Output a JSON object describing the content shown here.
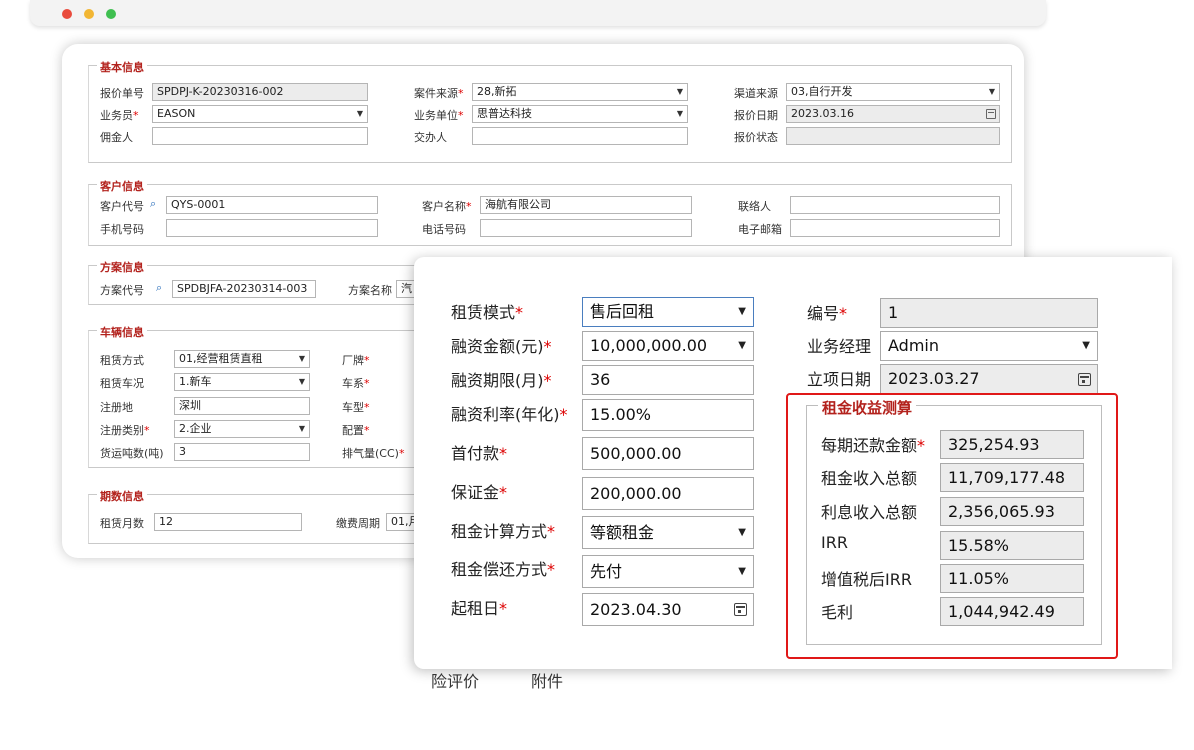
{
  "back": {
    "basic": {
      "title": "基本信息",
      "quote_no_label": "报价单号",
      "quote_no": "SPDPJ-K-20230316-002",
      "case_source_label": "案件来源",
      "case_source": "28,新拓",
      "channel_label": "渠道来源",
      "channel": "03,自行开发",
      "salesman_label": "业务员",
      "salesman": "EASON",
      "biz_unit_label": "业务单位",
      "biz_unit": "思普达科技",
      "quote_date_label": "报价日期",
      "quote_date": "2023.03.16",
      "broker_label": "佣金人",
      "handler_label": "交办人",
      "quote_status_label": "报价状态"
    },
    "customer": {
      "title": "客户信息",
      "code_label": "客户代号",
      "code": "QYS-0001",
      "name_label": "客户名称",
      "name": "海航有限公司",
      "contact_label": "联络人",
      "mobile_label": "手机号码",
      "phone_label": "电话号码",
      "email_label": "电子邮箱"
    },
    "plan": {
      "title": "方案信息",
      "code_label": "方案代号",
      "code": "SPDBJFA-20230314-003",
      "name_label": "方案名称",
      "name_partial": "汽"
    },
    "vehicle": {
      "title": "车辆信息",
      "lease_type_label": "租赁方式",
      "lease_type": "01,经营租赁直租",
      "brand_label": "厂牌",
      "condition_label": "租赁车况",
      "condition": "1.新车",
      "series_label": "车系",
      "reg_place_label": "注册地",
      "reg_place": "深圳",
      "model_label": "车型",
      "reg_type_label": "注册类别",
      "reg_type": "2.企业",
      "config_label": "配置",
      "tonnage_label": "货运吨数(吨)",
      "tonnage": "3",
      "displacement_label": "排气量(CC)"
    },
    "period": {
      "title": "期数信息",
      "months_label": "租赁月数",
      "months": "12",
      "pay_cycle_label": "缴费周期",
      "pay_cycle_partial": "01,月"
    }
  },
  "front": {
    "lease_mode_label": "租赁模式",
    "lease_mode": "售后回租",
    "finance_amount_label": "融资金额(元)",
    "finance_amount": "10,000,000.00",
    "term_label": "融资期限(月)",
    "term": "36",
    "rate_label": "融资利率(年化)",
    "rate": "15.00%",
    "down_payment_label": "首付款",
    "down_payment": "500,000.00",
    "deposit_label": "保证金",
    "deposit": "200,000.00",
    "calc_method_label": "租金计算方式",
    "calc_method": "等额租金",
    "repay_method_label": "租金偿还方式",
    "repay_method": "先付",
    "start_date_label": "起租日",
    "start_date": "2023.04.30",
    "number_label": "编号",
    "number": "1",
    "manager_label": "业务经理",
    "manager": "Admin",
    "project_date_label": "立项日期",
    "project_date": "2023.03.27",
    "tabs": [
      "险评价",
      "附件"
    ]
  },
  "calc": {
    "title": "租金收益测算",
    "period_payment_label": "每期还款金额",
    "period_payment": "325,254.93",
    "total_rent_label": "租金收入总额",
    "total_rent": "11,709,177.48",
    "total_interest_label": "利息收入总额",
    "total_interest": "2,356,065.93",
    "irr_label": "IRR",
    "irr": "15.58%",
    "vat_irr_label": "增值税后IRR",
    "vat_irr": "11.05%",
    "gross_profit_label": "毛利",
    "gross_profit": "1,044,942.49"
  },
  "colors": {
    "section_title": "#b3221d",
    "highlight_border": "#e01818",
    "required": "#dd0000"
  }
}
